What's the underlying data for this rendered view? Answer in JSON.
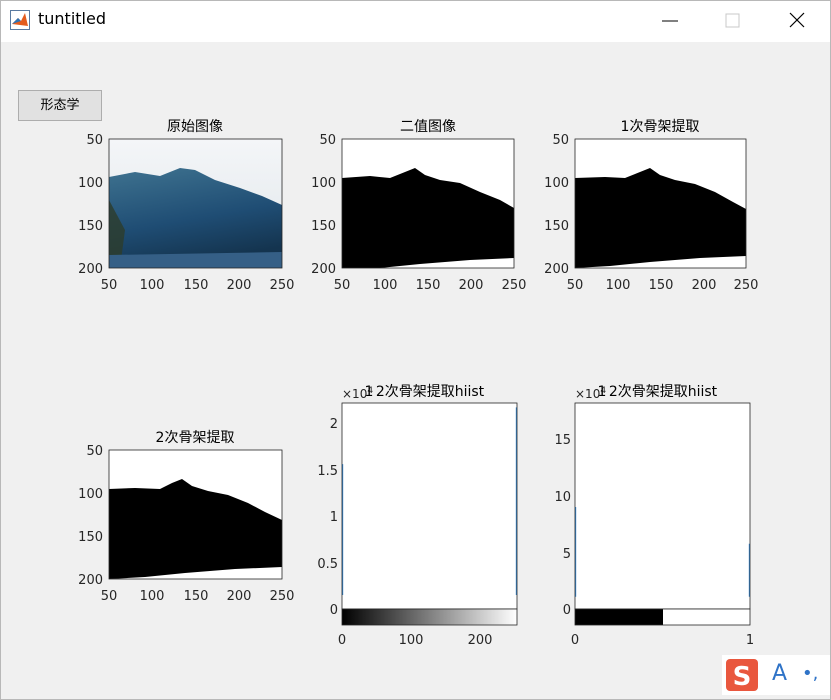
{
  "window": {
    "title": "tuntitled",
    "icon": "matlab-icon",
    "controls": {
      "minimize": "minimize-icon",
      "maximize": "maximize-icon",
      "close": "close-icon"
    }
  },
  "button": {
    "label": "形态学"
  },
  "image_axes": [
    {
      "title": "原始图像",
      "kind": "photo",
      "xticks": [
        "50",
        "100",
        "150",
        "200",
        "250"
      ],
      "yticks": [
        "50",
        "100",
        "150",
        "200"
      ]
    },
    {
      "title": "二值图像",
      "kind": "binary",
      "xticks": [
        "50",
        "100",
        "150",
        "200",
        "250"
      ],
      "yticks": [
        "50",
        "100",
        "150",
        "200"
      ]
    },
    {
      "title": "1次骨架提取",
      "kind": "binary",
      "xticks": [
        "50",
        "100",
        "150",
        "200",
        "250"
      ],
      "yticks": [
        "50",
        "100",
        "150",
        "200"
      ]
    },
    {
      "title": "2次骨架提取",
      "kind": "binary",
      "xticks": [
        "50",
        "100",
        "150",
        "200",
        "250"
      ],
      "yticks": [
        "50",
        "100",
        "150",
        "200"
      ]
    }
  ],
  "histograms": [
    {
      "title": "2次骨架提取hiist",
      "overlap_title": "1",
      "exponent_base": "×10",
      "exponent": "4",
      "yticks": [
        "2",
        "1.5",
        "1",
        "0.5",
        "0"
      ],
      "xticks": [
        "0",
        "100",
        "200"
      ]
    },
    {
      "title": "2次骨架提取hiist",
      "overlap_title": "1",
      "exponent_base": "×10",
      "exponent": "4",
      "yticks": [
        "15",
        "10",
        "5",
        "0"
      ],
      "xticks": [
        "0",
        "1"
      ]
    }
  ],
  "chart_data": [
    {
      "type": "bar",
      "title": "2次骨架提取hiist",
      "x": [
        0,
        255
      ],
      "values": [
        15000,
        21500
      ],
      "xlim": [
        0,
        255
      ],
      "ylim": [
        -1600,
        22000
      ],
      "colorbar": "gray-gradient"
    },
    {
      "type": "bar",
      "title": "2次骨架提取hiist",
      "x": [
        0,
        1
      ],
      "values": [
        88000,
        52000
      ],
      "xlim": [
        0,
        1
      ],
      "ylim": [
        -12000,
        190000
      ],
      "colorbar": "black-white"
    }
  ],
  "taskbar_ime": {
    "logo": "sogou-icon",
    "label": "A",
    "punct": "•,"
  },
  "colors": {
    "line": "#3a8ed8",
    "ime": "#e9573e",
    "ime_text": "#2f73c7"
  }
}
